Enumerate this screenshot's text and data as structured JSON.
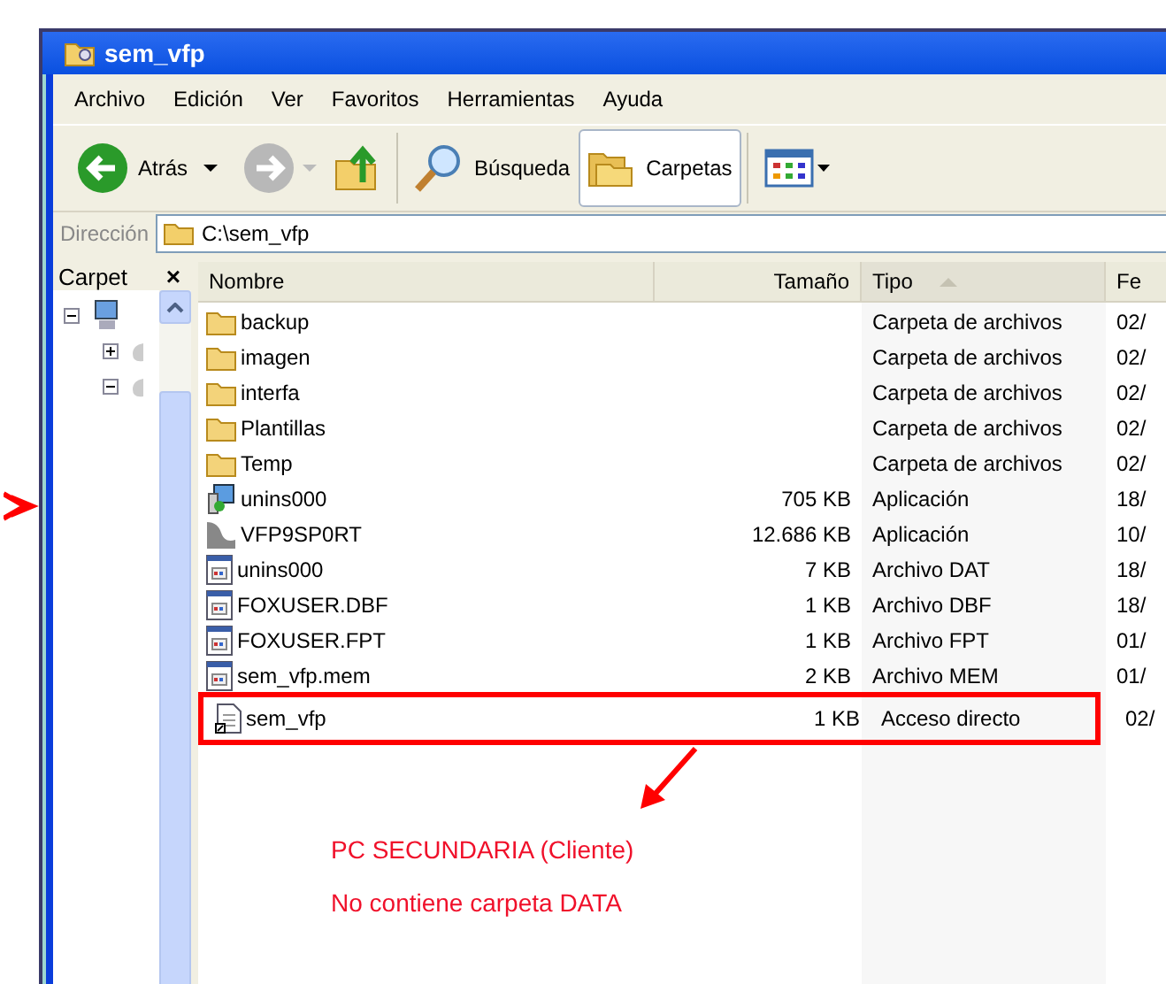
{
  "window": {
    "title": "sem_vfp"
  },
  "menu": [
    "Archivo",
    "Edición",
    "Ver",
    "Favoritos",
    "Herramientas",
    "Ayuda"
  ],
  "toolbar": {
    "back": {
      "label": "Atrás",
      "disabled": false
    },
    "forward": {
      "disabled": true
    },
    "search": {
      "label": "Búsqueda"
    },
    "folders": {
      "label": "Carpetas",
      "selected": true
    }
  },
  "address": {
    "label": "Dirección",
    "value": "C:\\sem_vfp"
  },
  "folder_pane": {
    "title": "Carpet",
    "close": "×"
  },
  "table": {
    "columns": [
      {
        "label": "Nombre",
        "sorted": false
      },
      {
        "label": "Tamaño",
        "sorted": false
      },
      {
        "label": "Tipo",
        "sorted": true
      },
      {
        "label": "Fe",
        "sorted": false
      }
    ],
    "rows": [
      {
        "kind": "folder",
        "name": "backup",
        "type": "Carpeta de archivos",
        "date": "02/",
        "marked": false
      },
      {
        "kind": "folder",
        "name": "imagen",
        "type": "Carpeta de archivos",
        "date": "02/",
        "marked": false
      },
      {
        "kind": "folder",
        "name": "interfa",
        "type": "Carpeta de archivos",
        "date": "02/",
        "marked": false
      },
      {
        "kind": "folder",
        "name": "Plantillas",
        "type": "Carpeta de archivos",
        "date": "02/",
        "marked": false
      },
      {
        "kind": "folder",
        "name": "Temp",
        "type": "Carpeta de archivos",
        "date": "02/",
        "marked": false
      },
      {
        "kind": "installer",
        "name": "unins000",
        "size": "705 KB",
        "type": "Aplicación",
        "date": "18/",
        "marked": false
      },
      {
        "kind": "app",
        "name": "VFP9SP0RT",
        "size": "12.686 KB",
        "type": "Aplicación",
        "date": "10/",
        "marked": false
      },
      {
        "kind": "file",
        "name": "unins000",
        "size": "7 KB",
        "type": "Archivo DAT",
        "date": "18/",
        "marked": false
      },
      {
        "kind": "file",
        "name": "FOXUSER.DBF",
        "size": "1 KB",
        "type": "Archivo DBF",
        "date": "18/",
        "marked": false
      },
      {
        "kind": "file",
        "name": "FOXUSER.FPT",
        "size": "1 KB",
        "type": "Archivo FPT",
        "date": "01/",
        "marked": false
      },
      {
        "kind": "file",
        "name": "sem_vfp.mem",
        "size": "2 KB",
        "type": "Archivo MEM",
        "date": "01/",
        "marked": false
      },
      {
        "kind": "shortcut",
        "name": "sem_vfp",
        "size": "1 KB",
        "type": "Acceso directo",
        "date": "02/",
        "marked": true
      }
    ]
  },
  "annotation": {
    "lines": [
      "PC SECUNDARIA (Cliente)",
      "No contiene carpeta DATA"
    ]
  }
}
